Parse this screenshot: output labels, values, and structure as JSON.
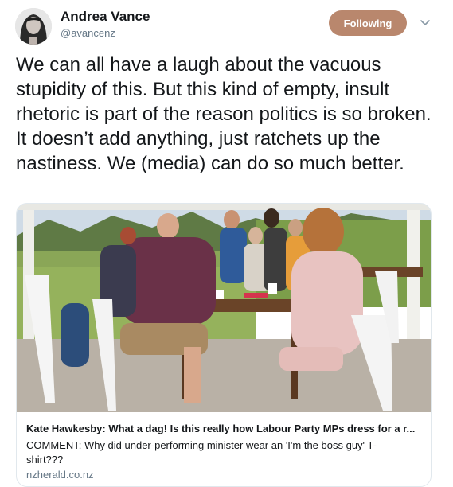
{
  "user": {
    "name": "Andrea Vance",
    "handle": "@avancenz",
    "follow_label": "Following"
  },
  "tweet": {
    "text": "We can all have a laugh about the vacuous stupidity of this. But this kind of empty, insult rhetoric is part of the reason politics is so broken. It doesn’t add anything, just ratchets up the nastiness. We (media) can do so much better."
  },
  "card": {
    "title": "Kate Hawkesby: What a dag! Is this really how Labour Party MPs dress for a r...",
    "description": "COMMENT: Why did under-performing minister wear an 'I'm the boss guy' T-shirt???",
    "domain": "nzherald.co.nz"
  },
  "icons": {
    "menu": "chevron-down-icon",
    "avatar": "avatar"
  },
  "colors": {
    "follow_button": "#b9876d",
    "secondary_text": "#657786"
  }
}
